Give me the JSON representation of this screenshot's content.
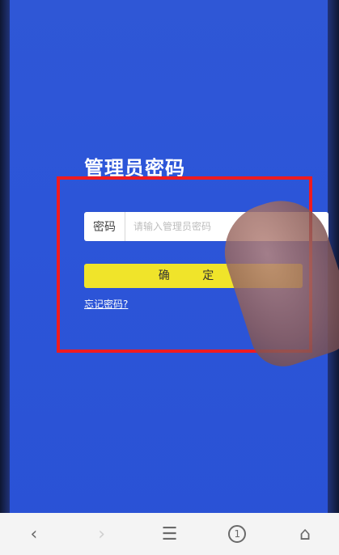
{
  "page": {
    "title": "管理员密码",
    "password_label": "密码",
    "password_placeholder": "请输入管理员密码",
    "confirm_label": "确 定",
    "forgot_link": "忘记密码?"
  },
  "nav": {
    "back_glyph": "‹",
    "forward_glyph": "›",
    "menu_glyph": "☰",
    "tabs_count": "1",
    "home_glyph": "⌂"
  },
  "colors": {
    "background": "#2c55d8",
    "confirm_button": "#f0e42a",
    "highlight_box": "#ef1b1f"
  }
}
